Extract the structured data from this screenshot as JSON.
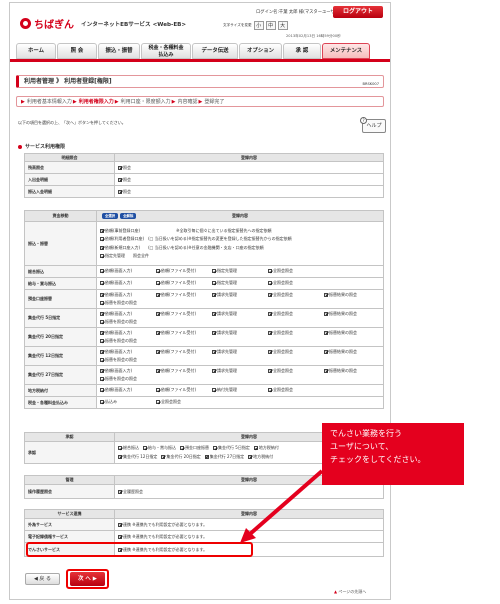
{
  "header": {
    "logo": "ちばぎん",
    "service": "インターネットEBサービス <Web-EB>",
    "login_user": "ログイン名:千葉 太郎 様(マスターユーザ)",
    "logout": "ログアウト",
    "font_size_label": "文字サイズを変更",
    "font_sizes": [
      "小",
      "中",
      "大"
    ],
    "last_login": "2013年02月13日 16時59分00秒"
  },
  "nav": {
    "items": [
      "ホーム",
      "照 会",
      "振込・振替",
      "税金・各種料金\n払込み",
      "データ伝送",
      "オプション",
      "承 認",
      "メンテナンス"
    ]
  },
  "page": {
    "title": "利用者管理 》 利用者登録[権限]",
    "screen_id": "BRSK007",
    "steps": [
      "利用者基本情報入力",
      "利用者権限入力",
      "利用口座・限度額入力",
      "内容確認",
      "登録完了"
    ],
    "instruction": "以下の項目を選択の上、「次へ」ボタンを押してください。",
    "help": "ヘルプ",
    "section": "サービス利用権限"
  },
  "table1": {
    "headers": [
      "明細照会",
      "登録内容"
    ],
    "rows": [
      {
        "label": "残高照会",
        "opts": [
          "照会"
        ]
      },
      {
        "label": "入出金明細",
        "opts": [
          "照会"
        ]
      },
      {
        "label": "振込入金明細",
        "opts": [
          "照会"
        ]
      }
    ]
  },
  "table2": {
    "headers": [
      "資金移動",
      "登録内容"
    ],
    "badges": [
      "全選択",
      "全解除"
    ],
    "furikomi_label": "振込・振替",
    "furikomi_lines": [
      "依頼(事前登録口座)　　　　　　　　　※全取引毎に個々に出ている指定振替先への指定依頼",
      "依頼(利用者登録口座)　(□ 当日扱いを認める)※指定振替先の変更を登録した指定振替先からの指定依頼",
      "依頼(新規口座入力)　　(□ 当日扱いを認める)※任意の金融機関・支店・口座の指定依頼",
      "指定先管理　　照会全件"
    ],
    "rows": [
      {
        "label": "総合振込",
        "opts": [
          "依頼(画面入力)",
          "依頼(ファイル受付)",
          "指定先管理",
          "全照会照会"
        ]
      },
      {
        "label": "給与・賞与振込",
        "opts": [
          "依頼(画面入力)",
          "依頼(ファイル受付)",
          "指定先管理",
          "全照会照会"
        ]
      },
      {
        "label": "預金口座振替",
        "opts": [
          "依頼(画面入力)",
          "依頼(ファイル受付)",
          "請求先管理",
          "全照会照会",
          "振替結果の照会"
        ],
        "extra": "振替を照会の照会"
      },
      {
        "label": "集金代行 5日指定",
        "opts": [
          "依頼(画面入力)",
          "依頼(ファイル受付)",
          "請求先管理",
          "全照会照会",
          "振替結果の照会"
        ],
        "extra": "振替を照会の照会"
      },
      {
        "label": "集金代行 20日指定",
        "opts": [
          "依頼(画面入力)",
          "依頼(ファイル受付)",
          "請求先管理",
          "全照会照会",
          "振替結果の照会"
        ],
        "extra": "振替を照会の照会"
      },
      {
        "label": "集金代行 12日指定",
        "opts": [
          "依頼(画面入力)",
          "依頼(ファイル受付)",
          "請求先管理",
          "全照会照会",
          "振替結果の照会"
        ],
        "extra": "振替を照会の照会"
      },
      {
        "label": "集金代行 27日指定",
        "opts": [
          "依頼(画面入力)",
          "依頼(ファイル受付)",
          "請求先管理",
          "全照会照会",
          "振替結果の照会"
        ],
        "extra": "振替を照会の照会"
      },
      {
        "label": "地方税納付",
        "opts": [
          "依頼(画面入力)",
          "依頼(ファイル受付)",
          "納付先管理",
          "全照会照会"
        ]
      },
      {
        "label": "税金・各種料金払込み",
        "opts": [
          "払込み",
          "全照会照会"
        ]
      }
    ]
  },
  "table3": {
    "headers": [
      "承認",
      "登録内容"
    ],
    "label": "承認",
    "line1": [
      "総合振込",
      "給与・賞与振込",
      "預金口座振替",
      "集金代行 5日指定",
      "地方税納付"
    ],
    "line2": [
      "集金代行 12日指定",
      "集金代行 20日指定",
      "集金代行 27日指定",
      "地方税納付"
    ]
  },
  "table4": {
    "headers": [
      "管理",
      "登録内容"
    ],
    "label": "操作履歴照会",
    "opt": "全履歴照会"
  },
  "table5": {
    "headers": [
      "サービス連携",
      "登録内容"
    ],
    "rows": [
      {
        "label": "外為サービス",
        "text": "連携 ※連携先でも利用設定が必要となります。"
      },
      {
        "label": "電子記録債権サービス",
        "text": "連携 ※連携先でも利用設定が必要となります。"
      },
      {
        "label": "でんさいサービス",
        "text": "連携 ※連携先でも利用設定が必要となります。"
      }
    ]
  },
  "buttons": {
    "back": "戻 る",
    "next": "次 へ"
  },
  "page_top": "ページの先頭へ",
  "callout": {
    "lines": [
      "でんさい業務を行う",
      "ユーザについて、",
      "チェックをしてください。"
    ],
    "color": "#e4001e"
  }
}
